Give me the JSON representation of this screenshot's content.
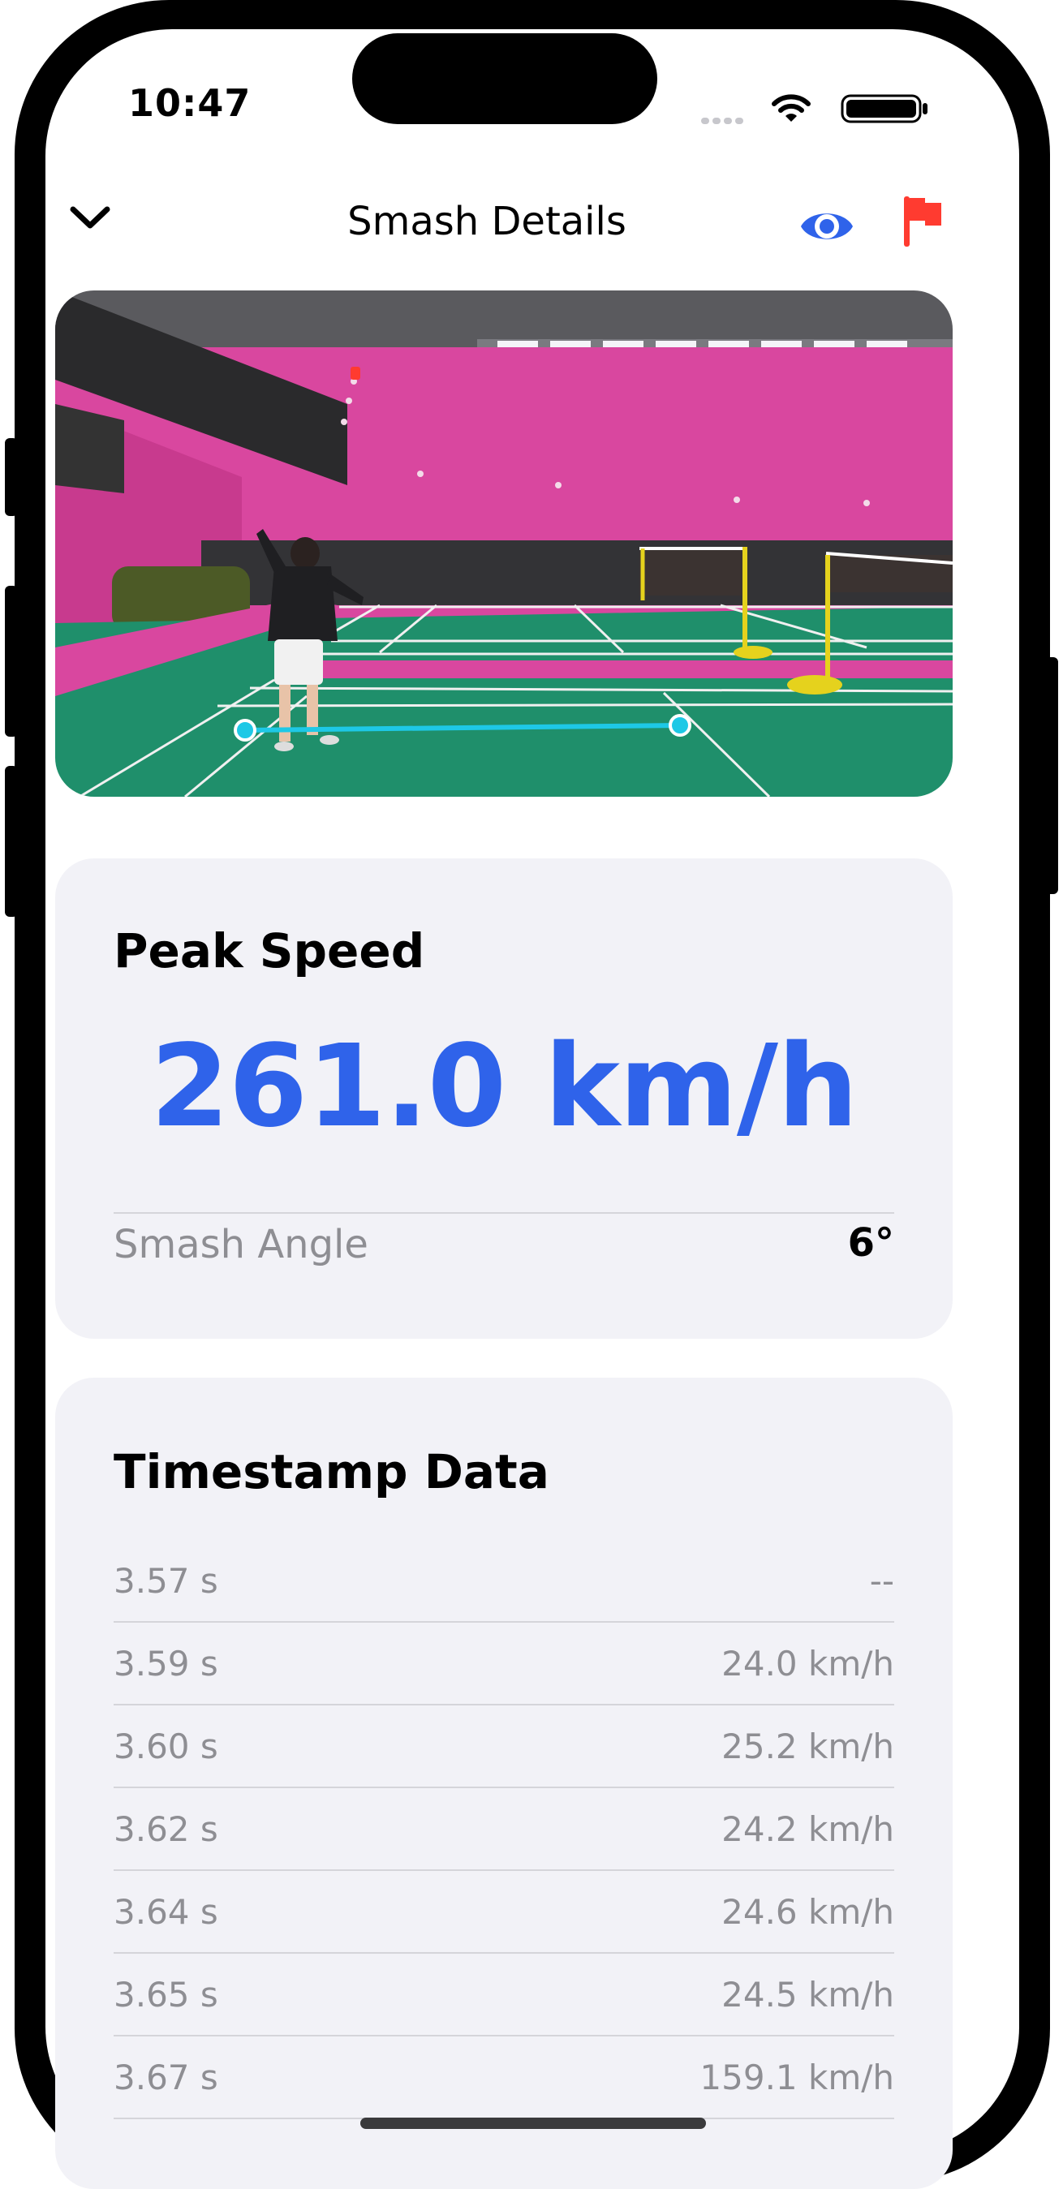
{
  "status_bar": {
    "time": "10:47"
  },
  "nav": {
    "title": "Smash Details",
    "icons": [
      "chevron-down-icon",
      "eye-icon",
      "flag-icon"
    ]
  },
  "peak_card": {
    "title": "Peak Speed",
    "value": "261.0 km/h",
    "angle_label": "Smash Angle",
    "angle_value": "6°"
  },
  "timestamps": {
    "title": "Timestamp Data",
    "rows": [
      {
        "time": "3.57 s",
        "speed": "--"
      },
      {
        "time": "3.59 s",
        "speed": "24.0 km/h"
      },
      {
        "time": "3.60 s",
        "speed": "25.2 km/h"
      },
      {
        "time": "3.62 s",
        "speed": "24.2 km/h"
      },
      {
        "time": "3.64 s",
        "speed": "24.6 km/h"
      },
      {
        "time": "3.65 s",
        "speed": "24.5 km/h"
      },
      {
        "time": "3.67 s",
        "speed": "159.1 km/h"
      }
    ]
  },
  "colors": {
    "accent_blue": "#2f63ea",
    "flag_red": "#ff3b30",
    "court_green": "#1f8f6b",
    "wall_pink": "#d9479f",
    "trajectory_cyan": "#1ec8e6"
  }
}
